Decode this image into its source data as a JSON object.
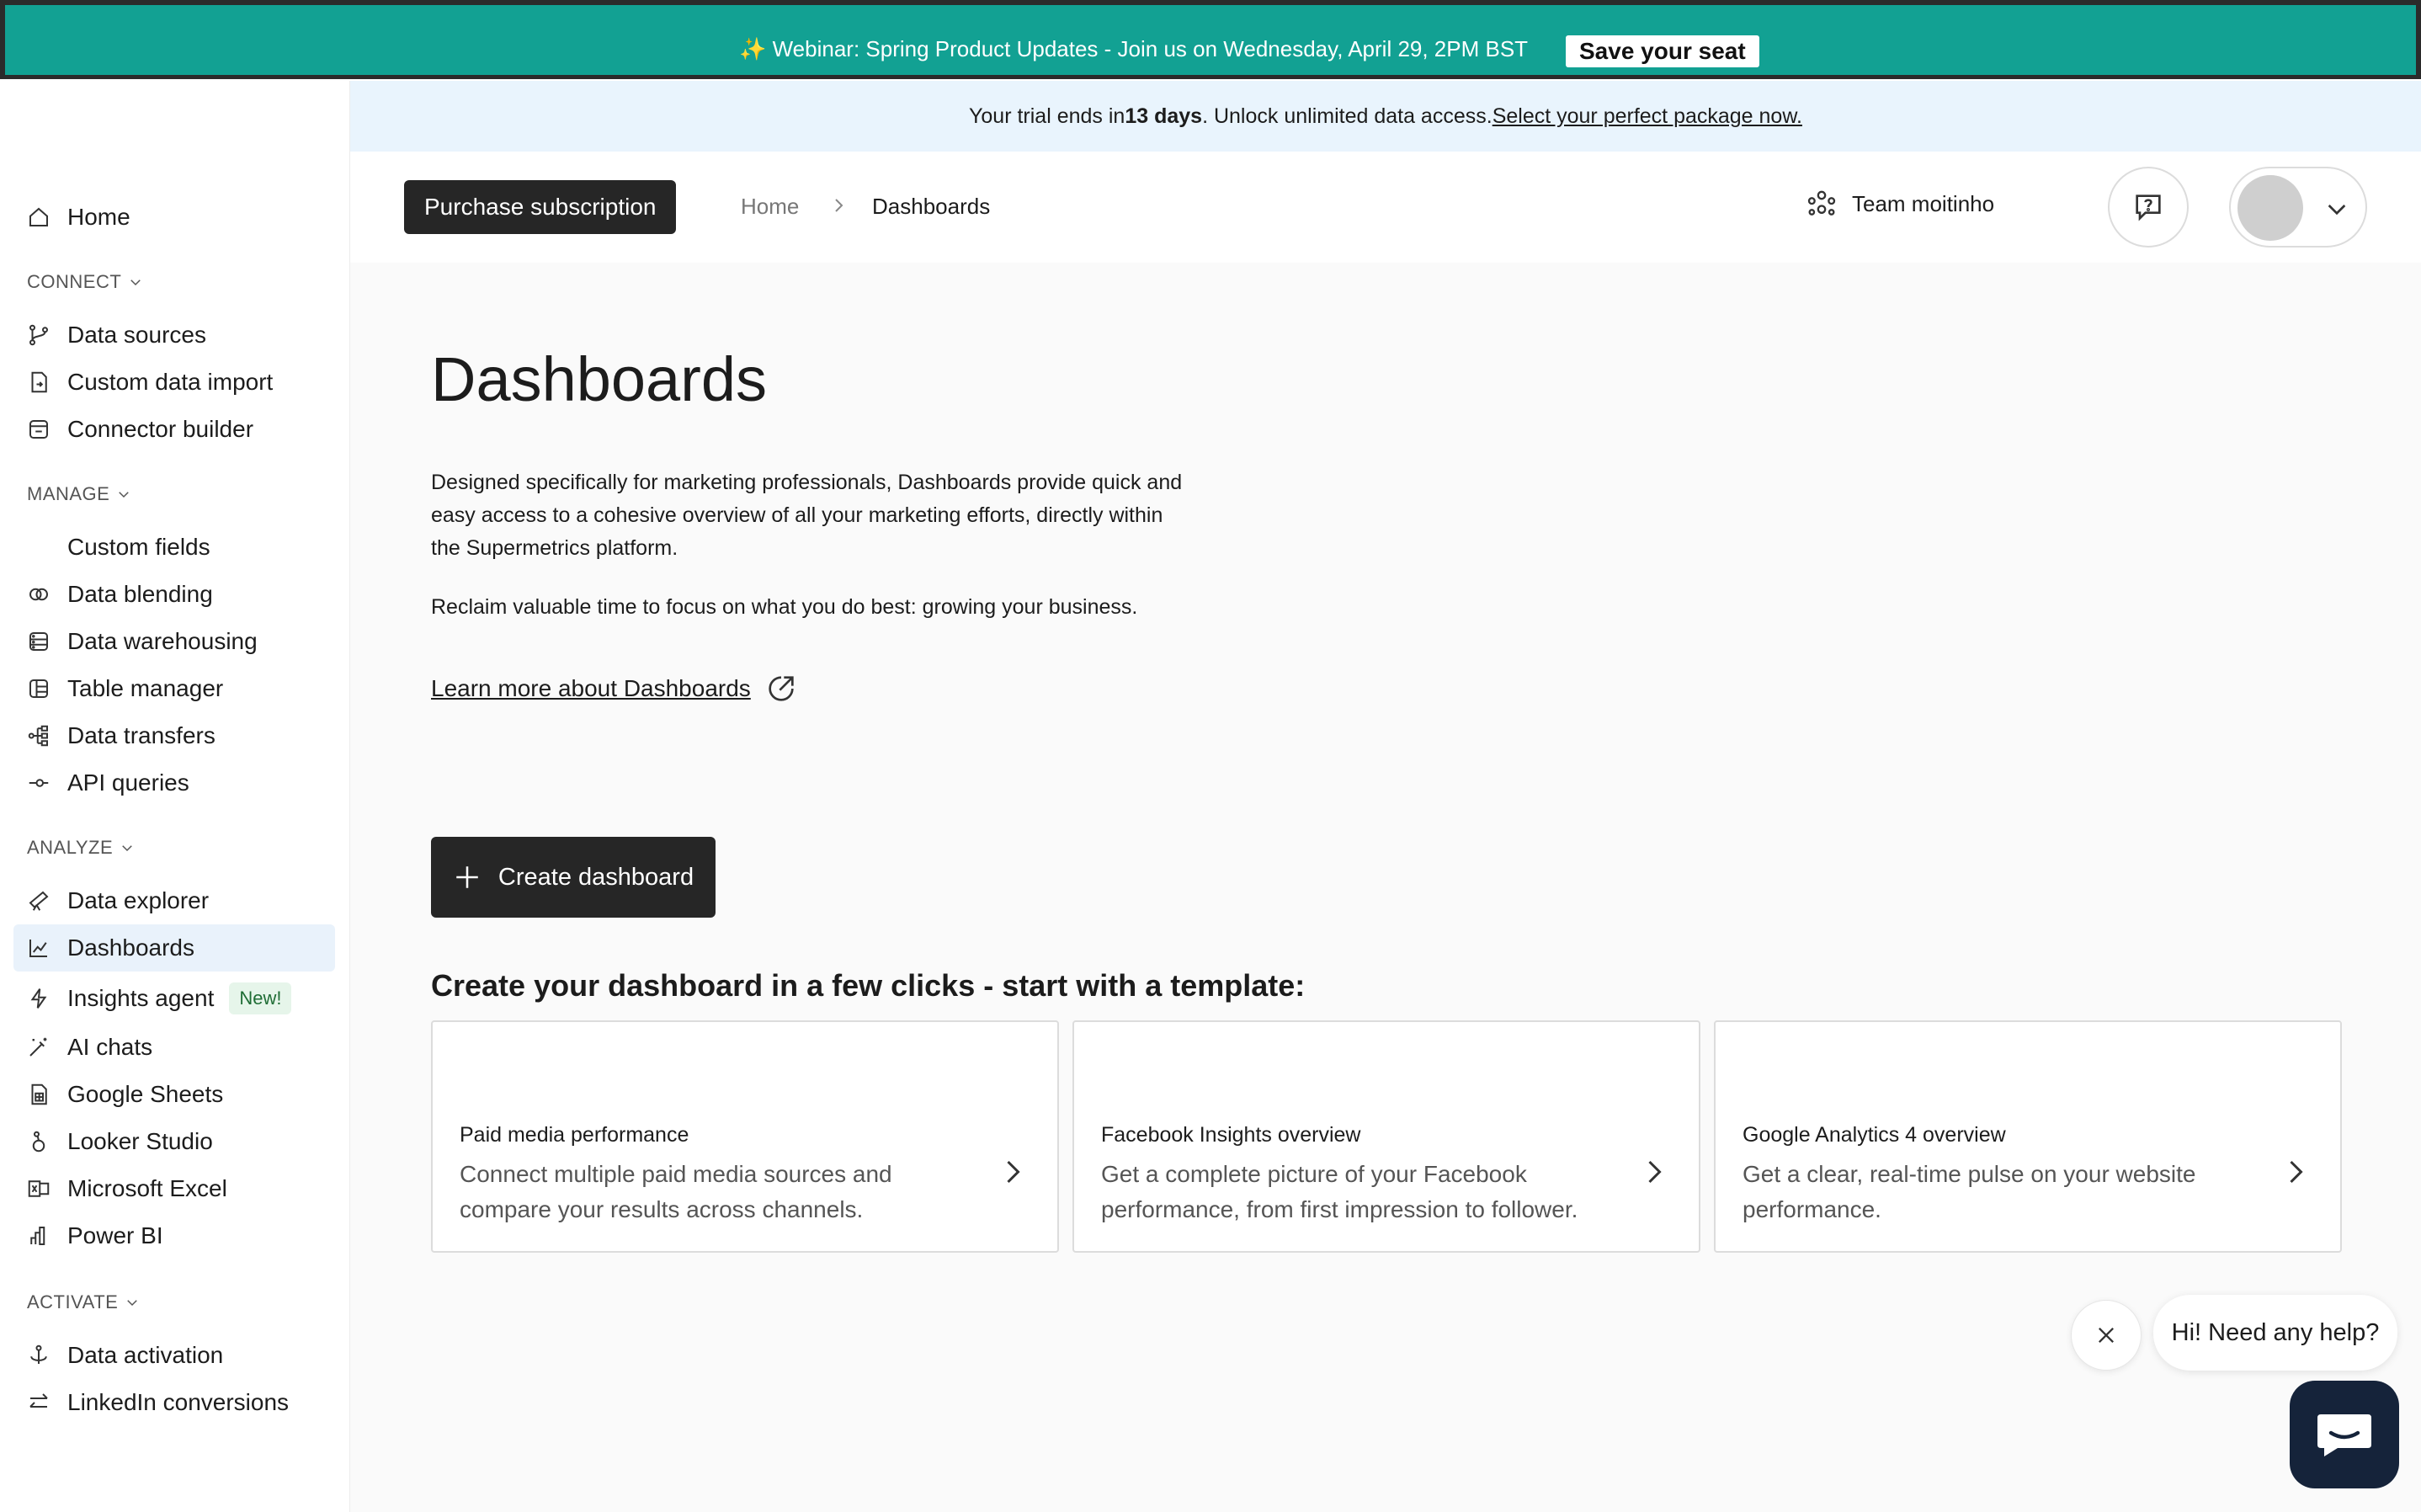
{
  "webinar": {
    "text": "✨ Webinar: Spring Product Updates - Join us on Wednesday, April 29, 2PM BST",
    "cta": "Save your seat"
  },
  "trial": {
    "prefix": "Your trial ends in",
    "days": "13 days",
    "middle": ". Unlock unlimited data access.",
    "link": "Select your perfect package now."
  },
  "sidebar": {
    "home": "Home",
    "sections": {
      "connect": "CONNECT",
      "manage": "MANAGE",
      "analyze": "ANALYZE",
      "activate": "ACTIVATE"
    },
    "connect_items": [
      "Data sources",
      "Custom data import",
      "Connector builder"
    ],
    "manage_items": [
      "Custom fields",
      "Data blending",
      "Data warehousing",
      "Table manager",
      "Data transfers",
      "API queries"
    ],
    "analyze_items": [
      "Data explorer",
      "Dashboards",
      "Insights agent",
      "AI chats",
      "Google Sheets",
      "Looker Studio",
      "Microsoft Excel",
      "Power BI"
    ],
    "activate_items": [
      "Data activation",
      "LinkedIn conversions"
    ],
    "new_badge": "New!"
  },
  "header": {
    "purchase": "Purchase subscription",
    "breadcrumb_home": "Home",
    "breadcrumb_current": "Dashboards",
    "team": "Team moitinho"
  },
  "main": {
    "title": "Dashboards",
    "description": "Designed specifically for marketing professionals, Dashboards provide quick and easy access to a cohesive overview of all your marketing efforts, directly within the Supermetrics platform.",
    "description2": "Reclaim valuable time to focus on what you do best: growing your business.",
    "learn_more": "Learn more about Dashboards",
    "create_button": "Create dashboard",
    "templates_heading": "Create your dashboard in a few clicks - start with a template:",
    "templates": [
      {
        "title": "Paid media performance",
        "desc": "Connect multiple paid media sources and compare your results across channels."
      },
      {
        "title": "Facebook Insights overview",
        "desc": "Get a complete picture of your Facebook performance, from first impression to follower."
      },
      {
        "title": "Google Analytics 4 overview",
        "desc": "Get a clear, real-time pulse on your website performance."
      }
    ]
  },
  "chat": {
    "bubble": "Hi! Need any help?"
  }
}
